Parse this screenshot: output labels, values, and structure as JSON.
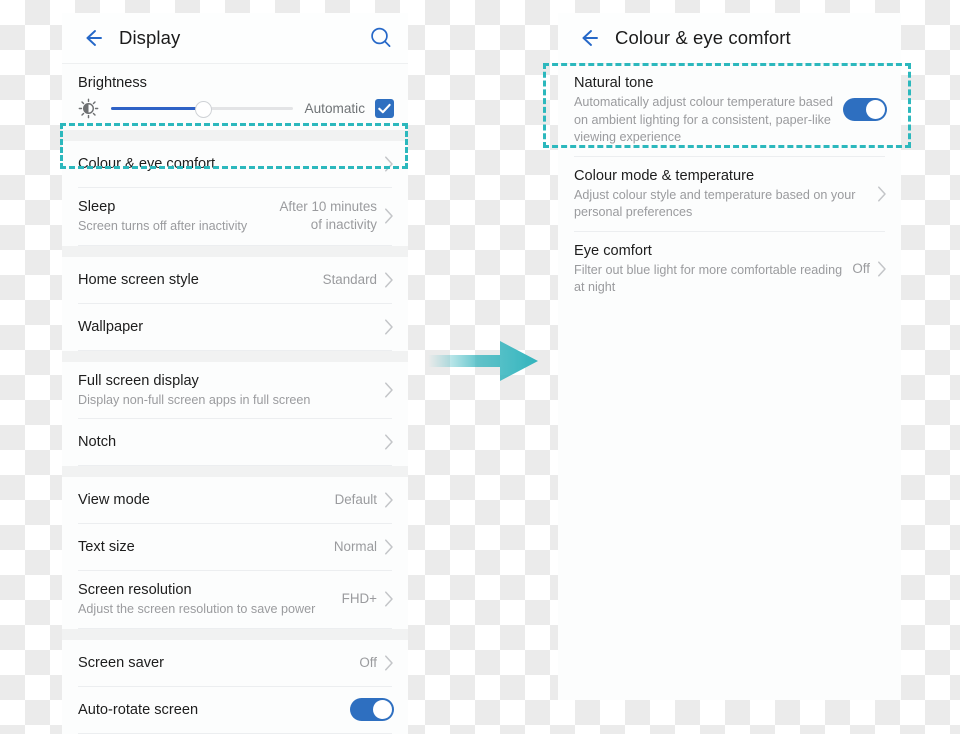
{
  "left_panel": {
    "appbar": {
      "back_icon": "back-arrow-icon",
      "title": "Display",
      "search_icon": "search-icon"
    },
    "brightness": {
      "label": "Brightness",
      "icon": "brightness-sun-icon",
      "slider_value": 50,
      "automatic_label": "Automatic",
      "automatic_checked": true,
      "check_icon": "check-icon"
    },
    "groups": [
      {
        "rows": [
          {
            "title": "Colour & eye comfort",
            "sub": "",
            "value": "",
            "chevron": true,
            "highlighted": true
          },
          {
            "title": "Sleep",
            "sub": "Screen turns off after inactivity",
            "value": "After 10 minutes of inactivity",
            "chevron": true,
            "value_two_line": true
          }
        ]
      },
      {
        "rows": [
          {
            "title": "Home screen style",
            "sub": "",
            "value": "Standard",
            "chevron": true
          },
          {
            "title": "Wallpaper",
            "sub": "",
            "value": "",
            "chevron": true
          }
        ]
      },
      {
        "rows": [
          {
            "title": "Full screen display",
            "sub": "Display non-full screen apps in full screen",
            "value": "",
            "chevron": true
          },
          {
            "title": "Notch",
            "sub": "",
            "value": "",
            "chevron": true
          }
        ]
      },
      {
        "rows": [
          {
            "title": "View mode",
            "sub": "",
            "value": "Default",
            "chevron": true
          },
          {
            "title": "Text size",
            "sub": "",
            "value": "Normal",
            "chevron": true
          },
          {
            "title": "Screen resolution",
            "sub": "Adjust the screen resolution to save power",
            "value": "FHD+",
            "chevron": true
          }
        ]
      },
      {
        "rows": [
          {
            "title": "Screen saver",
            "sub": "",
            "value": "Off",
            "chevron": true
          },
          {
            "title": "Auto-rotate screen",
            "sub": "",
            "value": "",
            "chevron": false,
            "toggle": true,
            "toggle_on": true
          }
        ]
      }
    ]
  },
  "right_panel": {
    "appbar": {
      "back_icon": "back-arrow-icon",
      "title": "Colour & eye comfort"
    },
    "rows": [
      {
        "title": "Natural tone",
        "sub": "Automatically adjust colour temperature based on ambient lighting for a consistent, paper-like viewing experience",
        "value": "",
        "chevron": false,
        "toggle": true,
        "toggle_on": true,
        "highlighted": true
      },
      {
        "title": "Colour mode & temperature",
        "sub": "Adjust colour style and temperature based on your personal preferences",
        "value": "",
        "chevron": true
      },
      {
        "title": "Eye comfort",
        "sub": "Filter out blue light for more comfortable reading at night",
        "value": "Off",
        "chevron": true
      }
    ]
  },
  "annotation": {
    "highlight_colour": "#2cb8bd",
    "arrow_icon": "right-arrow-icon",
    "arrow_colour": "#33b4bd"
  },
  "theme": {
    "accent_blue": "#2e6fc0",
    "slider_blue": "#2f62c6",
    "text_primary": "#1d1d1d",
    "text_secondary": "#9a9b9e",
    "panel_bg": "#fcfdfd",
    "page_checker_light": "#ffffff",
    "page_checker_dark": "#ebebeb"
  }
}
